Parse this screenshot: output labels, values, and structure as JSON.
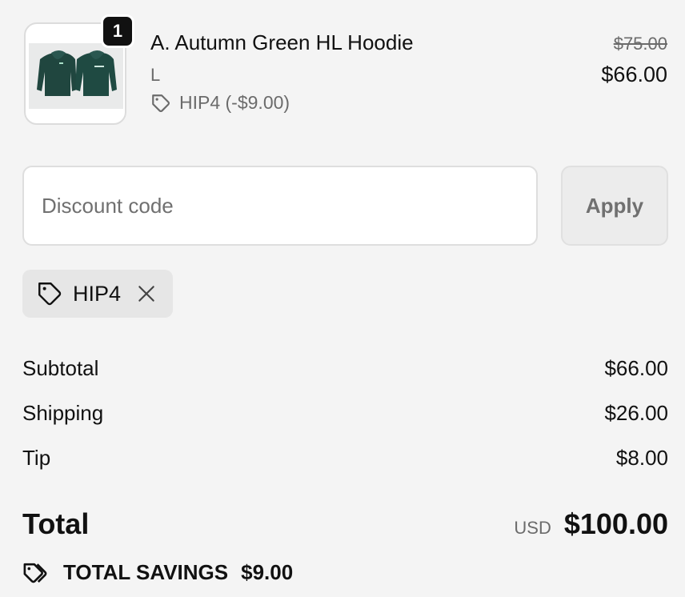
{
  "product": {
    "quantity": "1",
    "name": "A. Autumn Green HL Hoodie",
    "variant": "L",
    "discount_label": "HIP4 (-$9.00)",
    "original_price": "$75.00",
    "price": "$66.00",
    "image_icon": "hoodie-product-image"
  },
  "discount": {
    "placeholder": "Discount code",
    "apply_label": "Apply",
    "applied_code": "HIP4"
  },
  "summary": {
    "subtotal_label": "Subtotal",
    "subtotal_value": "$66.00",
    "shipping_label": "Shipping",
    "shipping_value": "$26.00",
    "tip_label": "Tip",
    "tip_value": "$8.00",
    "total_label": "Total",
    "currency": "USD",
    "total_value": "$100.00",
    "savings_label": "TOTAL SAVINGS",
    "savings_value": "$9.00"
  },
  "icons": {
    "tag": "tag-icon",
    "remove": "close-icon",
    "savings": "tags-icon"
  }
}
